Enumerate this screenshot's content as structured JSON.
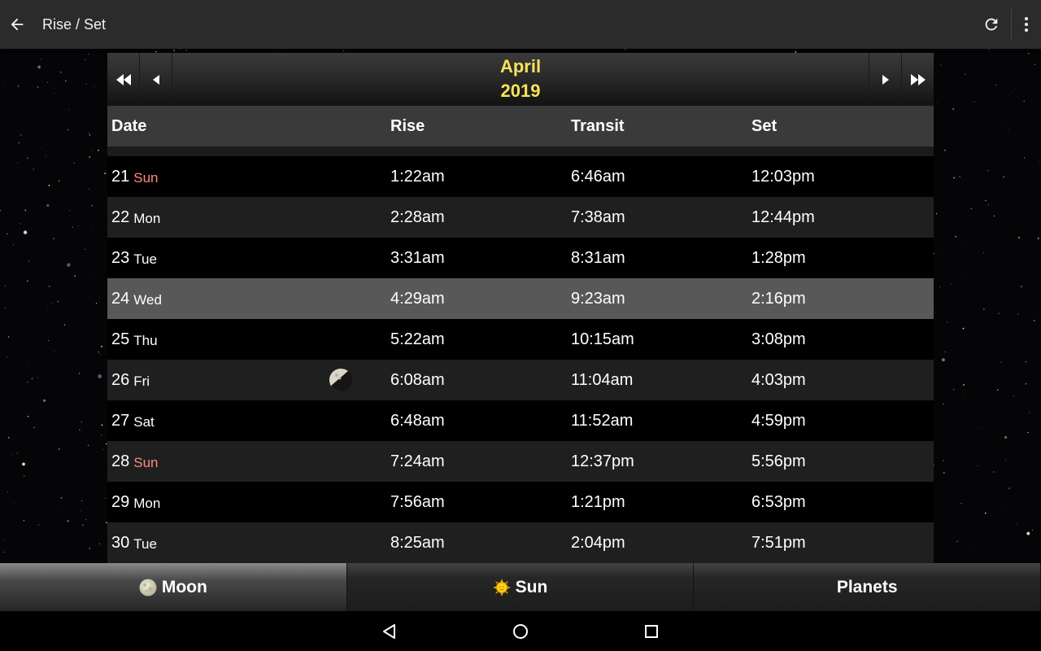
{
  "app_bar": {
    "title": "Rise / Set",
    "back_icon": "arrow-left-icon",
    "refresh_icon": "refresh-icon",
    "overflow_icon": "more-vertical-icon"
  },
  "month_nav": {
    "month": "April",
    "year": "2019",
    "prev_year_icon": "double-left-arrow-icon",
    "prev_month_icon": "left-arrow-icon",
    "next_month_icon": "right-arrow-icon",
    "next_year_icon": "double-right-arrow-icon"
  },
  "table": {
    "headers": {
      "date": "Date",
      "rise": "Rise",
      "transit": "Transit",
      "set": "Set"
    },
    "rows": [
      {
        "day": "21",
        "dow": "Sun",
        "rise": "1:22am",
        "transit": "6:46am",
        "set": "12:03pm"
      },
      {
        "day": "22",
        "dow": "Mon",
        "rise": "2:28am",
        "transit": "7:38am",
        "set": "12:44pm"
      },
      {
        "day": "23",
        "dow": "Tue",
        "rise": "3:31am",
        "transit": "8:31am",
        "set": "1:28pm"
      },
      {
        "day": "24",
        "dow": "Wed",
        "rise": "4:29am",
        "transit": "9:23am",
        "set": "2:16pm"
      },
      {
        "day": "25",
        "dow": "Thu",
        "rise": "5:22am",
        "transit": "10:15am",
        "set": "3:08pm"
      },
      {
        "day": "26",
        "dow": "Fri",
        "rise": "6:08am",
        "transit": "11:04am",
        "set": "4:03pm",
        "phase_icon": "last-quarter-moon-icon"
      },
      {
        "day": "27",
        "dow": "Sat",
        "rise": "6:48am",
        "transit": "11:52am",
        "set": "4:59pm"
      },
      {
        "day": "28",
        "dow": "Sun",
        "rise": "7:24am",
        "transit": "12:37pm",
        "set": "5:56pm"
      },
      {
        "day": "29",
        "dow": "Mon",
        "rise": "7:56am",
        "transit": "1:21pm",
        "set": "6:53pm"
      },
      {
        "day": "30",
        "dow": "Tue",
        "rise": "8:25am",
        "transit": "2:04pm",
        "set": "7:51pm"
      }
    ],
    "highlighted_day": "24"
  },
  "tabs": [
    {
      "label": "Moon",
      "icon": "moon-icon",
      "active": true
    },
    {
      "label": "Sun",
      "icon": "sun-icon",
      "active": false
    },
    {
      "label": "Planets",
      "icon": "",
      "active": false
    }
  ],
  "colors": {
    "month_text": "#f6e35a",
    "sunday_text": "#ff8a80",
    "highlight_row": "#585858"
  },
  "system_nav": {
    "back_icon": "nav-back-triangle-icon",
    "home_icon": "nav-home-circle-icon",
    "recents_icon": "nav-recents-square-icon"
  }
}
